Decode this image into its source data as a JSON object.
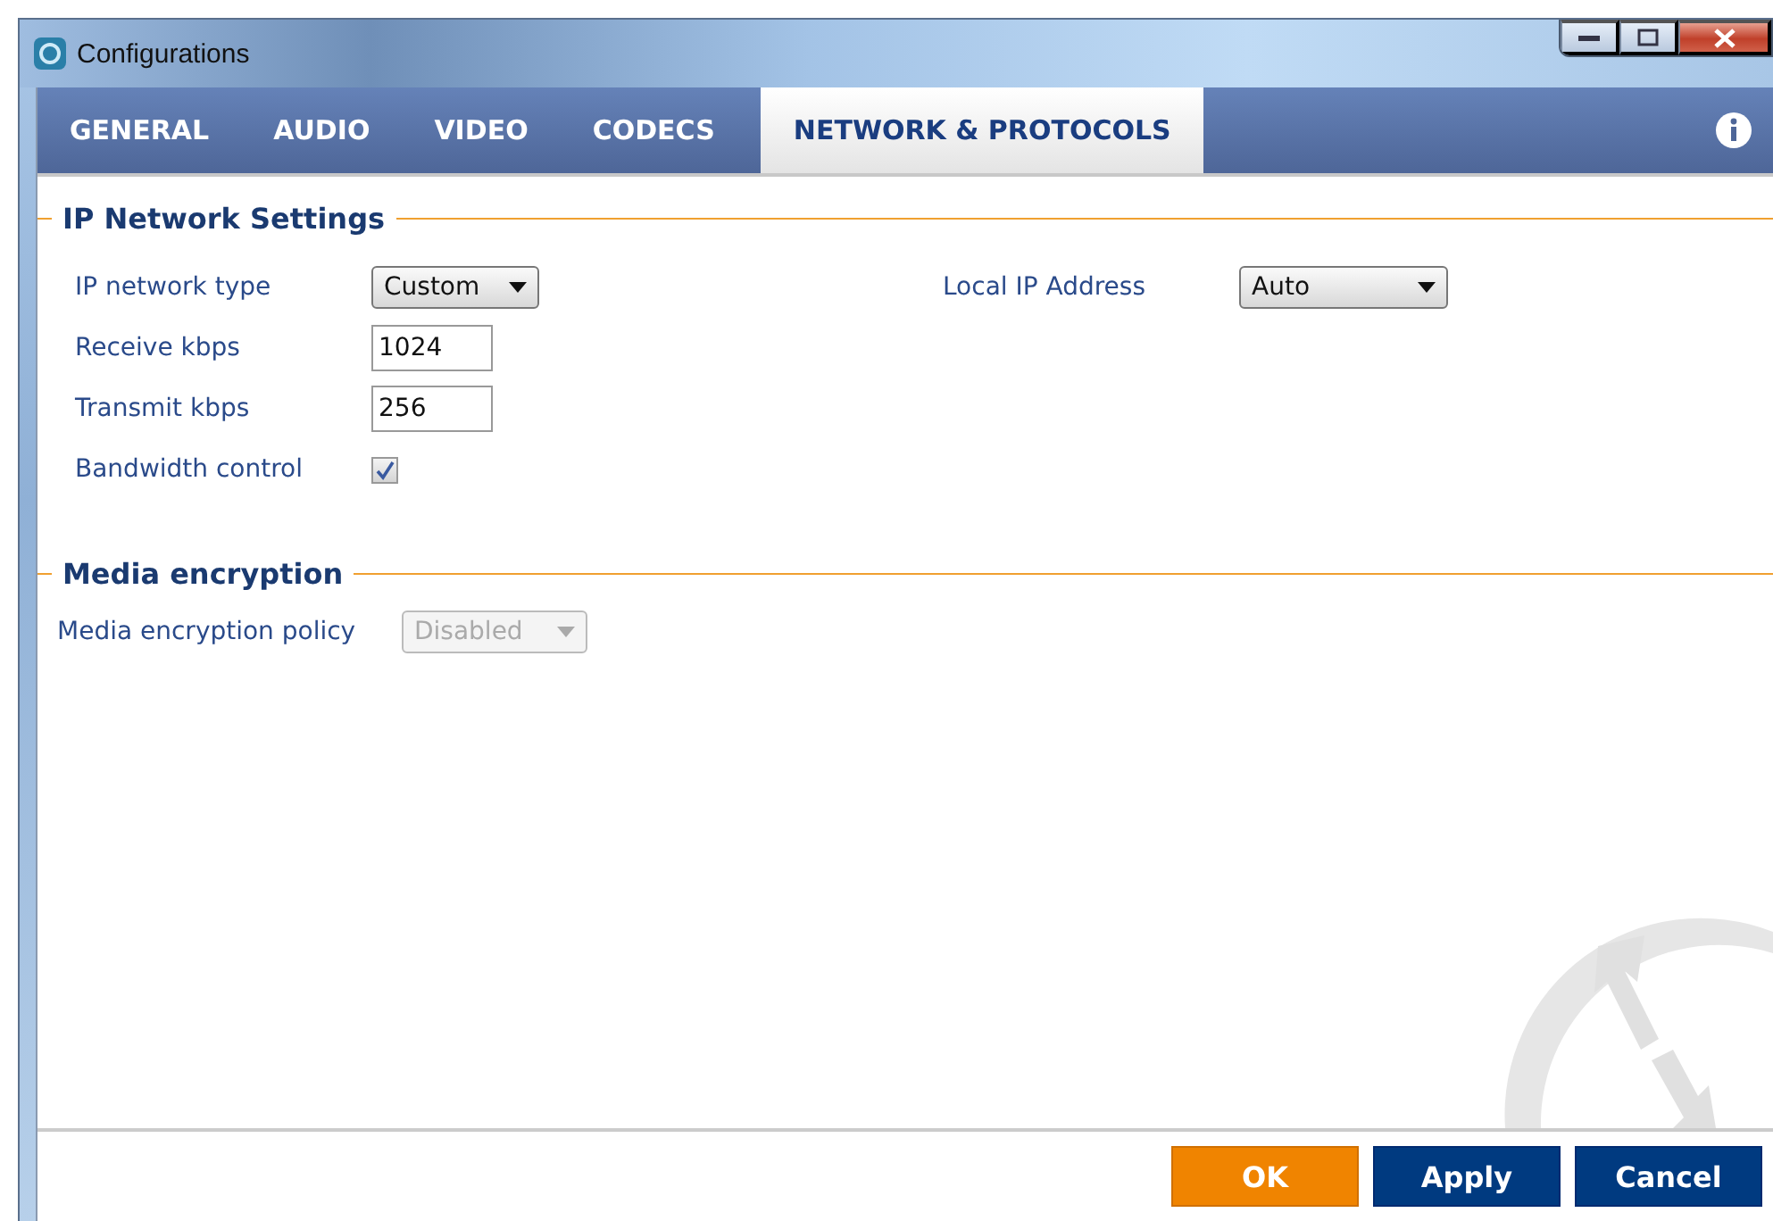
{
  "window": {
    "title": "Configurations"
  },
  "tabs": [
    {
      "label": "GENERAL",
      "selected": false
    },
    {
      "label": "AUDIO",
      "selected": false
    },
    {
      "label": "VIDEO",
      "selected": false
    },
    {
      "label": "CODECS",
      "selected": false
    },
    {
      "label": "NETWORK & PROTOCOLS",
      "selected": true
    }
  ],
  "sections": [
    {
      "title": "IP Network Settings",
      "fields": [
        {
          "kind": "dropdown",
          "label": "IP network type",
          "value": "Custom",
          "disabled": false
        },
        {
          "kind": "text",
          "label": "Receive kbps",
          "value": "1024",
          "disabled": false
        },
        {
          "kind": "text",
          "label": "Transmit kbps",
          "value": "256",
          "disabled": false
        },
        {
          "kind": "checkbox",
          "label": "Bandwidth control",
          "checked": true,
          "disabled": false
        }
      ],
      "side_fields": [
        {
          "kind": "dropdown",
          "label": "Local IP Address",
          "value": "Auto",
          "disabled": false
        }
      ]
    },
    {
      "title": "Media encryption",
      "fields": [
        {
          "kind": "dropdown",
          "label": "Media encryption policy",
          "value": "Disabled",
          "disabled": true
        }
      ]
    }
  ],
  "buttons": [
    {
      "label": "OK",
      "kind": "primary"
    },
    {
      "label": "Apply",
      "kind": "secondary"
    },
    {
      "label": "Cancel",
      "kind": "secondary"
    }
  ]
}
